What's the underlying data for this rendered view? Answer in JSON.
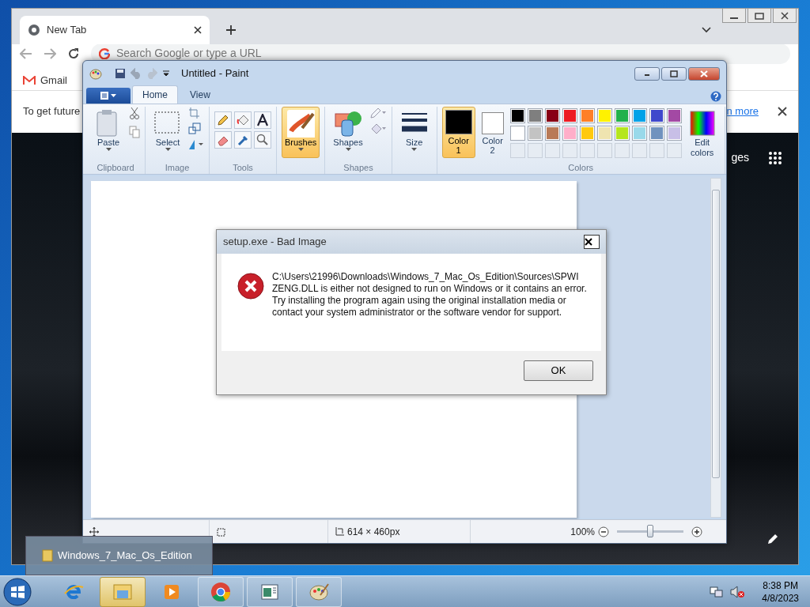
{
  "chrome": {
    "tab": {
      "title": "New Tab"
    },
    "address": {
      "placeholder": "Search Google or type a URL"
    },
    "bookmarks": [
      "Gmail"
    ],
    "infobar": {
      "text": "To get future",
      "link": "n more"
    },
    "apps_text": "ges"
  },
  "paint": {
    "title": "Untitled - Paint",
    "tabs": [
      {
        "label": "Home",
        "selected": true
      },
      {
        "label": "View",
        "selected": false
      }
    ],
    "groups": [
      {
        "label": "Clipboard",
        "tools": [
          {
            "kind": "big",
            "label": "Paste",
            "selected": false
          }
        ]
      },
      {
        "label": "Image",
        "tools": [
          {
            "kind": "big",
            "label": "Select",
            "selected": false
          }
        ]
      },
      {
        "label": "Tools",
        "tools": [
          {
            "kind": "grid"
          }
        ]
      },
      {
        "tools": [
          {
            "kind": "big",
            "label": "Brushes",
            "selected": true
          }
        ]
      },
      {
        "label": "Shapes",
        "tools": [
          {
            "kind": "big",
            "label": "Shapes",
            "selected": false
          }
        ]
      },
      {
        "tools": [
          {
            "kind": "big",
            "label": "Size",
            "selected": false
          }
        ]
      },
      {
        "label": "Colors",
        "tools": [
          {
            "kind": "color",
            "label": "Color\n1",
            "selected": true,
            "color": "#000000"
          },
          {
            "kind": "color",
            "label": "Color\n2",
            "selected": false,
            "color": "#ffffff"
          },
          {
            "kind": "palette"
          },
          {
            "kind": "big",
            "label": "Edit\ncolors",
            "selected": false
          }
        ]
      }
    ],
    "palette": [
      {
        "color": "#000000"
      },
      {
        "color": "#7f7f7f"
      },
      {
        "color": "#880015"
      },
      {
        "color": "#ed1c24"
      },
      {
        "color": "#ff7f27"
      },
      {
        "color": "#fff200"
      },
      {
        "color": "#22b14c"
      },
      {
        "color": "#00a2e8"
      },
      {
        "color": "#3f48cc"
      },
      {
        "color": "#a349a4"
      },
      {
        "color": "#ffffff"
      },
      {
        "color": "#c3c3c3"
      },
      {
        "color": "#b97a57"
      },
      {
        "color": "#ffaec9"
      },
      {
        "color": "#ffc90e"
      },
      {
        "color": "#efe4b0"
      },
      {
        "color": "#b5e61d"
      },
      {
        "color": "#99d9ea"
      },
      {
        "color": "#7092be"
      },
      {
        "color": "#c8bfe7"
      }
    ],
    "status": {
      "size": "614 × 460px",
      "zoom": "100%",
      "zoom_slider": {
        "level": 0.5
      }
    }
  },
  "dialog": {
    "title": "setup.exe - Bad Image",
    "message": "C:\\Users\\21996\\Downloads\\Windows_7_Mac_Os_Edition\\Sources\\SPWI ZENG.DLL is either not designed to run on Windows or it contains an error. Try installing the program again using the original installation media or contact your system administrator or the software vendor for support.",
    "button": "OK"
  },
  "thumbnail": {
    "title": "Windows_7_Mac_Os_Edition"
  },
  "taskbar": {
    "items": [
      {
        "kind": "ie",
        "selected": false
      },
      {
        "kind": "explorer",
        "selected": true
      },
      {
        "kind": "media",
        "selected": false
      },
      {
        "kind": "chrome",
        "selected": false
      },
      {
        "kind": "notepad",
        "selected": false
      },
      {
        "kind": "paint",
        "selected": false
      }
    ],
    "time": "8:38 PM",
    "date": "4/8/2023"
  }
}
